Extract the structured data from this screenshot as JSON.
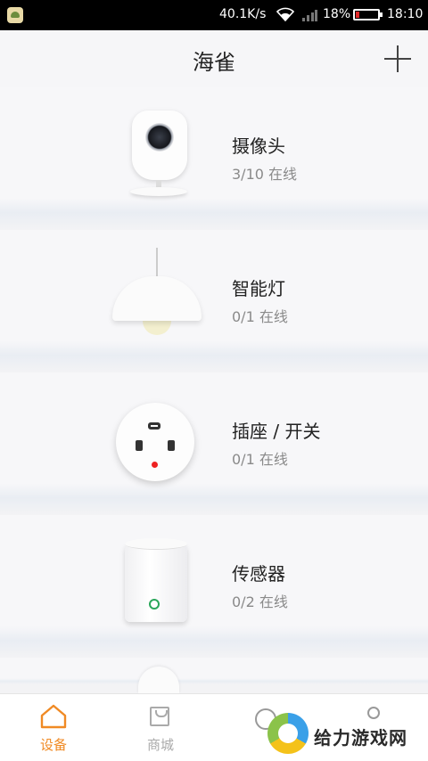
{
  "status_bar": {
    "network_speed": "40.1K/s",
    "battery_percent": "18%",
    "battery_level": 0.18,
    "time": "18:10",
    "icons": [
      "app-notification-icon",
      "wifi-icon",
      "signal-icon",
      "battery-icon"
    ]
  },
  "header": {
    "title": "海雀",
    "add_icon": "plus-icon"
  },
  "devices": [
    {
      "name": "摄像头",
      "status": "3/10 在线",
      "icon": "camera-icon"
    },
    {
      "name": "智能灯",
      "status": "0/1 在线",
      "icon": "lamp-icon"
    },
    {
      "name": "插座 / 开关",
      "status": "0/1 在线",
      "icon": "socket-icon"
    },
    {
      "name": "传感器",
      "status": "0/2 在线",
      "icon": "sensor-icon"
    }
  ],
  "bottom_nav": {
    "items": [
      {
        "label": "设备",
        "icon": "home-icon",
        "active": true
      },
      {
        "label": "商城",
        "icon": "shopping-bag-icon",
        "active": false
      },
      {
        "label": "",
        "icon": "clock-icon",
        "active": false
      },
      {
        "label": "",
        "icon": "person-icon",
        "active": false
      }
    ]
  },
  "watermark": {
    "text": "给力游戏网"
  },
  "colors": {
    "accent": "#f08a24",
    "socket_dot": "#ee2222",
    "sensor_led": "#2aa65a",
    "battery_low": "#e02a2a"
  }
}
